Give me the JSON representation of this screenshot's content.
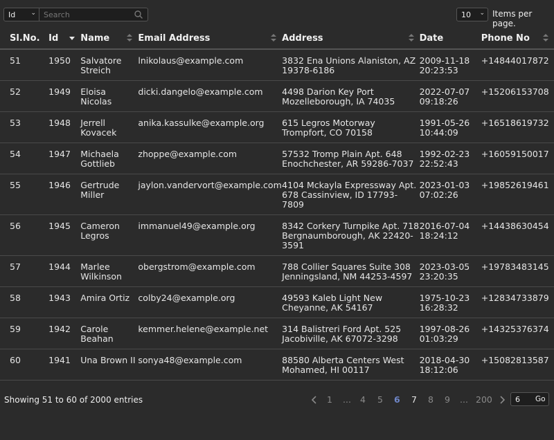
{
  "toolbar": {
    "field_select": "Id",
    "search_placeholder": "Search",
    "per_page_value": "10",
    "per_page_label": "Items per page."
  },
  "columns": [
    "Sl.No.",
    "Id",
    "Name",
    "Email Address",
    "Address",
    "Date",
    "Phone No"
  ],
  "rows": [
    {
      "sl": "51",
      "id": "1950",
      "name": "Salvatore Streich",
      "email": "lnikolaus@example.com",
      "address": "3832 Ena Unions Alaniston, AZ 19378-6186",
      "date": "2009-11-18 20:23:53",
      "phone": "+14844017872"
    },
    {
      "sl": "52",
      "id": "1949",
      "name": "Eloisa Nicolas",
      "email": "dicki.dangelo@example.com",
      "address": "4498 Darion Key Port Mozelleborough, IA 74035",
      "date": "2022-07-07 09:18:26",
      "phone": "+15206153708"
    },
    {
      "sl": "53",
      "id": "1948",
      "name": "Jerrell Kovacek",
      "email": "anika.kassulke@example.org",
      "address": "615 Legros Motorway Trompfort, CO 70158",
      "date": "1991-05-26 10:44:09",
      "phone": "+16518619732"
    },
    {
      "sl": "54",
      "id": "1947",
      "name": "Michaela Gottlieb",
      "email": "zhoppe@example.com",
      "address": "57532 Tromp Plain Apt. 648 Enochchester, AR 59286-7037",
      "date": "1992-02-23 22:52:43",
      "phone": "+16059150017"
    },
    {
      "sl": "55",
      "id": "1946",
      "name": "Gertrude Miller",
      "email": "jaylon.vandervort@example.com",
      "address": "4104 Mckayla Expressway Apt. 678 Cassinview, ID 17793-7809",
      "date": "2023-01-03 07:02:26",
      "phone": "+19852619461"
    },
    {
      "sl": "56",
      "id": "1945",
      "name": "Cameron Legros",
      "email": "immanuel49@example.org",
      "address": "8342 Corkery Turnpike Apt. 718 Bergnaumborough, AK 22420-3591",
      "date": "2016-07-04 18:24:12",
      "phone": "+14438630454"
    },
    {
      "sl": "57",
      "id": "1944",
      "name": "Marlee Wilkinson",
      "email": "obergstrom@example.com",
      "address": "788 Collier Squares Suite 308 Jenningsland, NM 44253-4597",
      "date": "2023-03-05 23:20:35",
      "phone": "+19783483145"
    },
    {
      "sl": "58",
      "id": "1943",
      "name": "Amira Ortiz",
      "email": "colby24@example.org",
      "address": "49593 Kaleb Light New Cheyanne, AK 54167",
      "date": "1975-10-23 16:28:32",
      "phone": "+12834733879"
    },
    {
      "sl": "59",
      "id": "1942",
      "name": "Carole Beahan",
      "email": "kemmer.helene@example.net",
      "address": "314 Balistreri Ford Apt. 525 Jacobiville, AK 67072-3298",
      "date": "1997-08-26 01:03:29",
      "phone": "+14325376374"
    },
    {
      "sl": "60",
      "id": "1941",
      "name": "Una Brown II",
      "email": "sonya48@example.com",
      "address": "88580 Alberta Centers West Mohamed, HI 00117",
      "date": "2018-04-30 18:12:06",
      "phone": "+15082813587"
    }
  ],
  "footer": {
    "showing": "Showing 51 to 60 of 2000 entries",
    "pages": [
      "1",
      "...",
      "4",
      "5",
      "6",
      "7",
      "8",
      "9",
      "...",
      "200"
    ],
    "current_page": "6",
    "goto_value": "6",
    "go_label": "Go"
  },
  "colors": {
    "background": "#2b2b2b",
    "current_page": "#6f87c9"
  }
}
